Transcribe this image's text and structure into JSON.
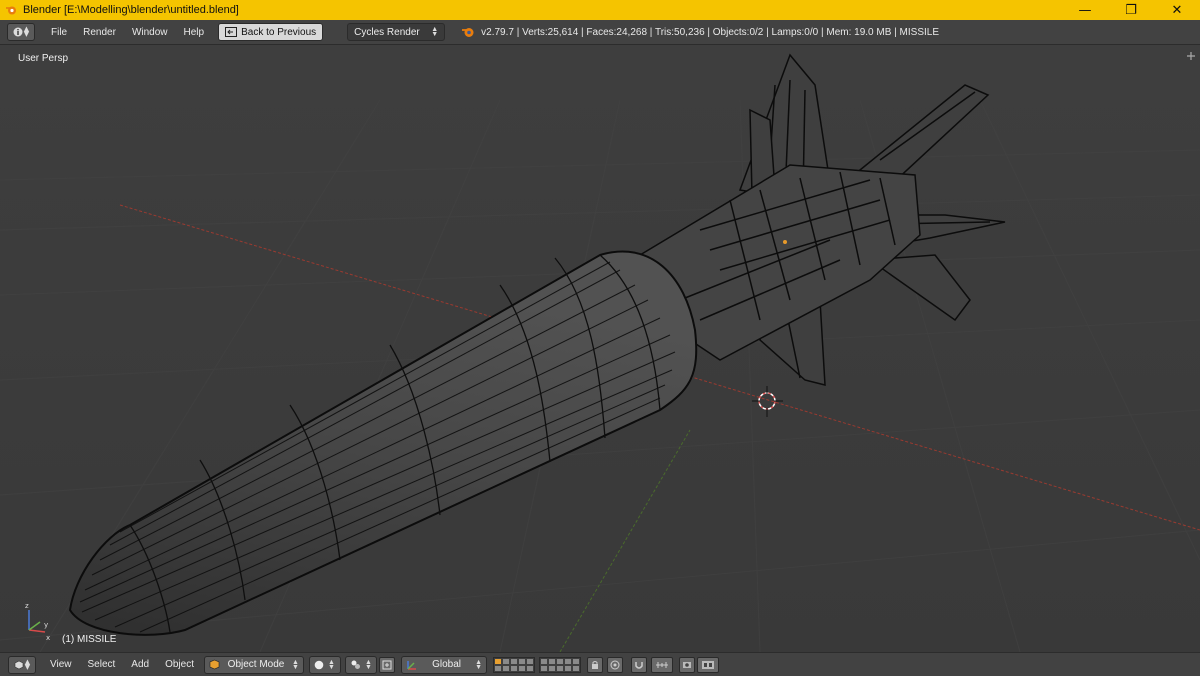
{
  "window": {
    "title": "Blender [E:\\Modelling\\blender\\untitled.blend]",
    "minimize_glyph": "—",
    "maximize_glyph": "❐",
    "close_glyph": "✕"
  },
  "info_header": {
    "menu": [
      "File",
      "Render",
      "Window",
      "Help"
    ],
    "back_button": "Back to Previous",
    "render_engine": "Cycles Render",
    "stats": "v2.79.7 | Verts:25,614 | Faces:24,268 | Tris:50,236 | Objects:0/2 | Lamps:0/0 | Mem: 19.0 MB | MISSILE"
  },
  "viewport": {
    "view_label": "User Persp",
    "object_label": "(1) MISSILE",
    "object_name": "MISSILE"
  },
  "bottom_header": {
    "menu": [
      "View",
      "Select",
      "Add",
      "Object"
    ],
    "mode": "Object Mode",
    "orientation": "Global"
  },
  "colors": {
    "titlebar": "#f5c400",
    "header_bg": "#424242",
    "viewport_bg": "#3b3b3b",
    "x_axis": "#9a3a30",
    "y_axis": "#4a6b2c",
    "wire": "#0d0d0d",
    "mesh": "#3a3a3a"
  }
}
